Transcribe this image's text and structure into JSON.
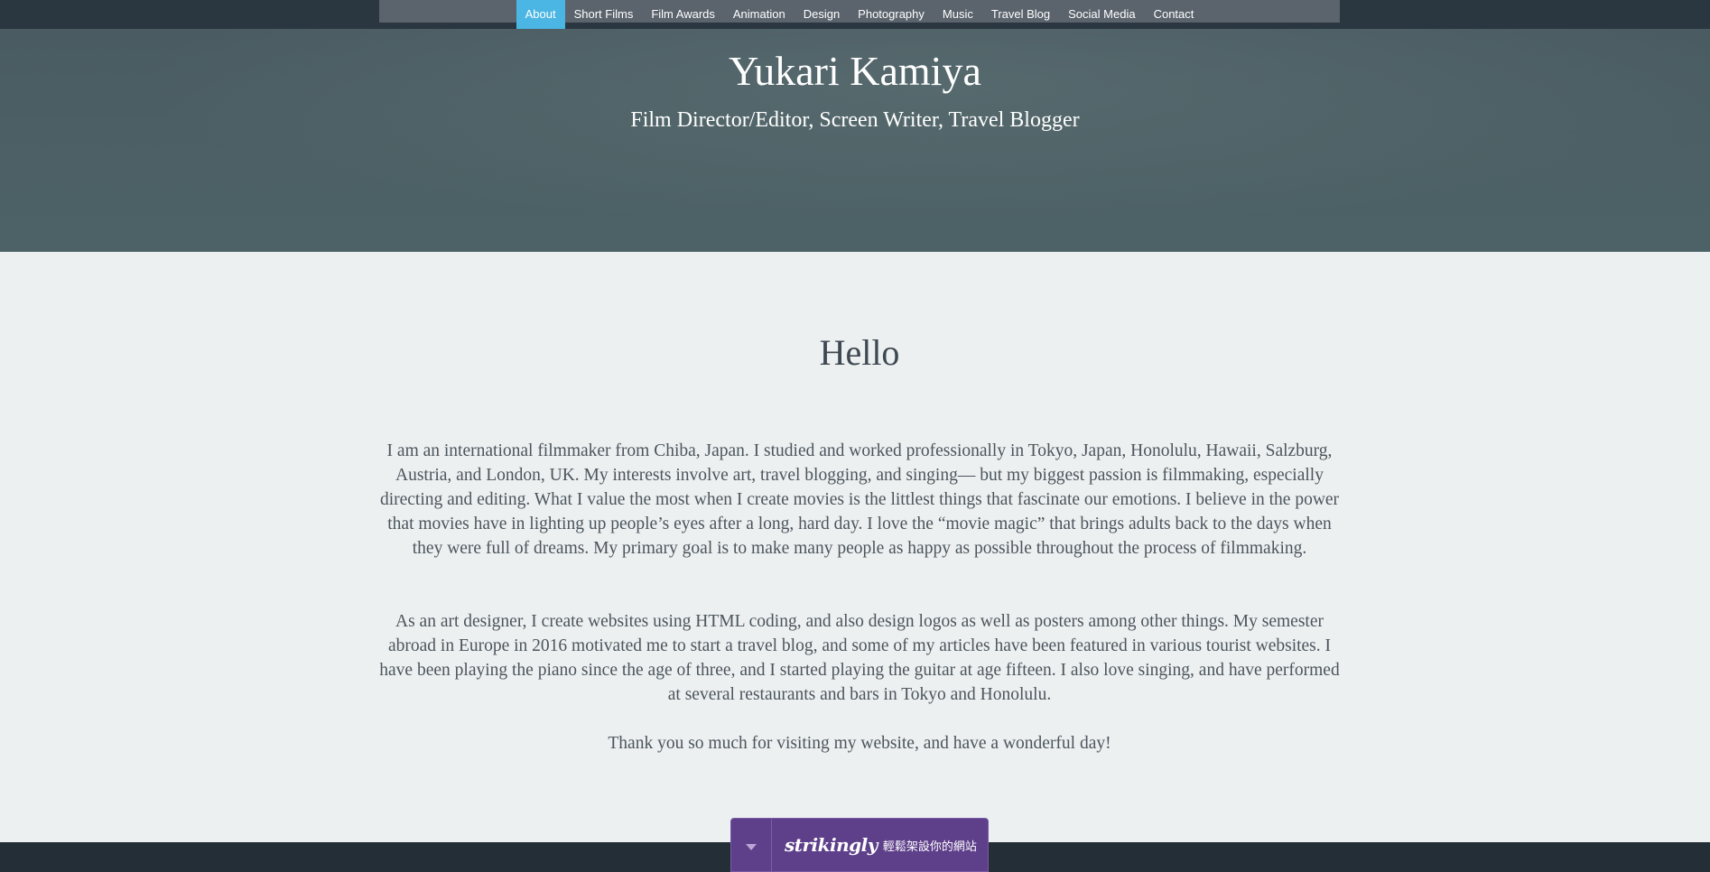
{
  "nav": {
    "items": [
      {
        "label": "About",
        "active": true
      },
      {
        "label": "Short Films"
      },
      {
        "label": "Film Awards"
      },
      {
        "label": "Animation"
      },
      {
        "label": "Design"
      },
      {
        "label": "Photography"
      },
      {
        "label": "Music"
      },
      {
        "label": "Travel Blog"
      },
      {
        "label": "Social Media"
      },
      {
        "label": "Contact"
      }
    ]
  },
  "hero": {
    "title": "Yukari Kamiya",
    "subtitle": "Film Director/Editor, Screen Writer, Travel Blogger"
  },
  "main": {
    "heading": "Hello",
    "paragraphs": [
      "I am an international filmmaker from Chiba, Japan. I studied and worked professionally in Tokyo, Japan, Honolulu, Hawaii, Salzburg, Austria, and London, UK. My interests involve art, travel blogging, and singing— but my biggest passion is filmmaking, especially directing and editing. What I value the most when I create movies is the littlest things that fascinate our emotions. I believe in the power that movies have in lighting up people’s eyes after a long, hard day. I love the “movie magic” that brings adults back to the days when they were full of dreams. My primary goal is to make many people as happy as possible throughout the process of filmmaking.",
      "As an art designer, I create websites using HTML coding, and also design logos as well as posters among other things. My semester abroad in Europe in 2016 motivated me to start a travel blog, and some of my articles have been featured in various tourist websites. I have been playing the piano since the age of three, and I started playing the guitar at age fifteen. I also love singing, and have performed at several restaurants and bars in Tokyo and Honolulu.",
      "Thank you so much for visiting my website, and have a wonderful day!"
    ]
  },
  "badge": {
    "brand": "strikingly",
    "tagline": "輕鬆架設你的網站",
    "toggle_icon": "chevron-down-icon"
  },
  "colors": {
    "topbar": "#2a3640",
    "nav_bg": "#5b636c",
    "nav_active": "#4bb6e3",
    "hero_bg": "#4c6065",
    "page_bg": "#ecf0f1",
    "footer": "#232e37",
    "badge": "#5e3f8a"
  }
}
